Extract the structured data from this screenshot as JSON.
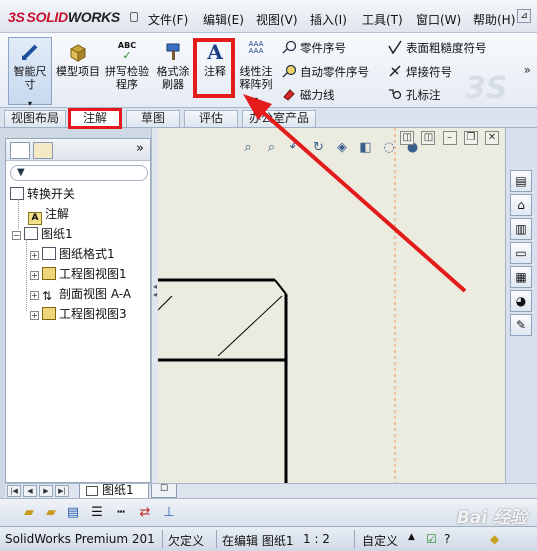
{
  "app": {
    "logo_prefix": "3S",
    "logo_brand": "SOLID",
    "logo_suffix": "WORKS"
  },
  "menu": [
    "文件(F)",
    "编辑(E)",
    "视图(V)",
    "插入(I)",
    "工具(T)",
    "窗口(W)",
    "帮助(H)"
  ],
  "ribbon": {
    "smart_dimension": "智能尺寸",
    "model_items": "模型项目",
    "spell_checker": "拼写检验程序",
    "format_painter": "格式涂刷器",
    "note": "注释",
    "linear_note_pattern": "线性注释阵列",
    "balloon": "零件序号",
    "auto_balloon": "自动零件序号",
    "magnetic_line": "磁力线",
    "surface_finish": "表面粗糙度符号",
    "weld_symbol": "焊接符号",
    "hole_callout": "孔标注",
    "spell_icon_text": "ABC",
    "more": "»"
  },
  "tabs": [
    "视图布局",
    "注解",
    "草图",
    "评估",
    "办公室产品"
  ],
  "active_tab": "注解",
  "tree": {
    "root": "转换开关",
    "annotations": "注解",
    "sheet": "图纸1",
    "sheet_format": "图纸格式1",
    "drawing_view1": "工程图视图1",
    "section_view": "剖面视图 A-A",
    "drawing_view3": "工程图视图3"
  },
  "sheet_tab": "图纸1",
  "status": {
    "product": "SolidWorks Premium 201",
    "underdefined": "欠定义",
    "editing": "在编辑 图纸1",
    "scale": "1 : 2",
    "units": "自定义"
  },
  "watermark": "Bai 经验",
  "colors": {
    "highlight": "#e31b1b",
    "drawing_bg": "#ecebe0",
    "ribbon_bg": "#e6ecf4"
  }
}
